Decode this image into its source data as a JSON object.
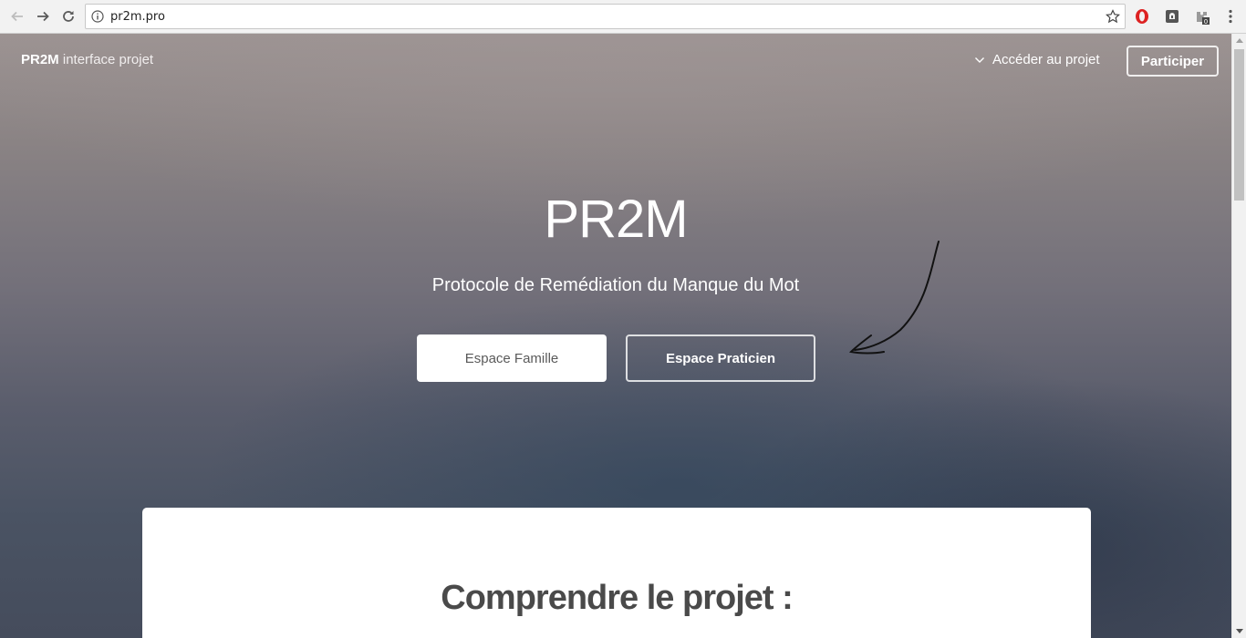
{
  "browser": {
    "url": "pr2m.pro",
    "extension_badge": "0"
  },
  "nav": {
    "brand_bold": "PR2M",
    "brand_sub": "interface projet",
    "access_label": "Accéder au projet",
    "participate_label": "Participer"
  },
  "hero": {
    "title": "PR2M",
    "subtitle": "Protocole de Remédiation du Manque du Mot",
    "btn_famille": "Espace Famille",
    "btn_praticien": "Espace Praticien"
  },
  "card": {
    "title": "Comprendre le projet :"
  },
  "colors": {
    "card_bg": "#ffffff",
    "text_light": "#ffffff"
  }
}
